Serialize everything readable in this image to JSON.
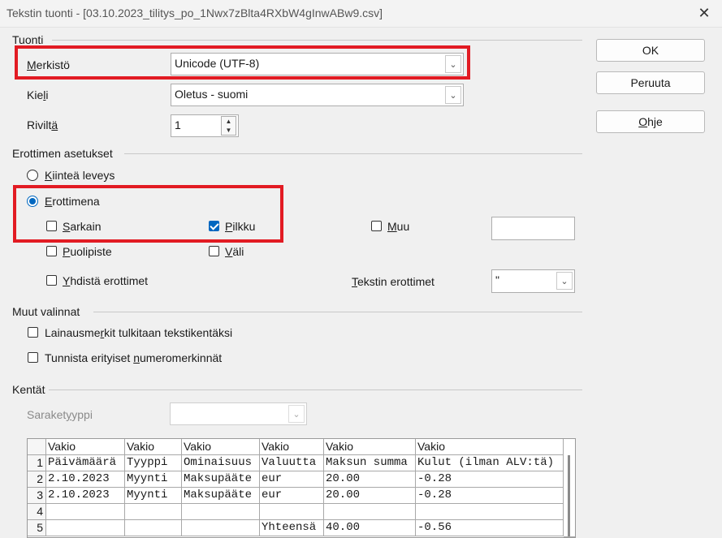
{
  "window": {
    "title": "Tekstin tuonti - [03.10.2023_tilitys_po_1Nwx7zBlta4RXbW4gInwABw9.csv]",
    "close_icon": "close-icon"
  },
  "import": {
    "section": "Tuonti",
    "charset_label": "Merkistö",
    "charset_value": "Unicode (UTF-8)",
    "language_label": "Kieli",
    "language_value": "Oletus - suomi",
    "from_row_label": "Riviltä",
    "from_row_value": "1"
  },
  "separator": {
    "section": "Erottimen asetukset",
    "fixed_width": "Kiinteä leveys",
    "separated_by": "Erottimena",
    "tab": "Sarkain",
    "comma": "Pilkku",
    "other": "Muu",
    "semicolon": "Puolipiste",
    "space": "Väli",
    "merge": "Yhdistä erottimet",
    "string_delim_label": "Tekstin erottimet",
    "string_delim_value": "\"",
    "other_value": ""
  },
  "other_options": {
    "section": "Muut valinnat",
    "quoted_as_text": "Lainausmerkit tulkitaan tekstikentäksi",
    "detect_special": "Tunnista erityiset numeromerkinnät"
  },
  "fields": {
    "section": "Kentät",
    "column_type_label": "Saraketyyppi",
    "column_type_value": ""
  },
  "buttons": {
    "ok": "OK",
    "cancel": "Peruuta",
    "help": "Ohje"
  },
  "grid": {
    "headers": [
      "Vakio",
      "Vakio",
      "Vakio",
      "Vakio",
      "Vakio",
      "Vakio"
    ],
    "rows": [
      {
        "num": "1",
        "cells": [
          "Päivämäärä",
          "Tyyppi",
          "Ominaisuus",
          "Valuutta",
          "Maksun summa",
          "Kulut (ilman ALV:tä)"
        ]
      },
      {
        "num": "2",
        "cells": [
          "2.10.2023",
          "Myynti",
          "Maksupääte",
          "eur",
          "20.00",
          "-0.28"
        ]
      },
      {
        "num": "3",
        "cells": [
          "2.10.2023",
          "Myynti",
          "Maksupääte",
          "eur",
          "20.00",
          "-0.28"
        ]
      },
      {
        "num": "4",
        "cells": [
          "",
          "",
          "",
          "",
          "",
          ""
        ]
      },
      {
        "num": "5",
        "cells": [
          "",
          "",
          "",
          "Yhteensä",
          "40.00",
          "-0.56"
        ]
      }
    ]
  },
  "state": {
    "separated_selected": true,
    "fixed_selected": false,
    "comma_checked": true,
    "tab_checked": false,
    "other_checked": false,
    "semicolon_checked": false,
    "space_checked": false,
    "merge_checked": false,
    "quoted_checked": false,
    "detect_checked": false
  },
  "colors": {
    "accent": "#0067c0",
    "highlight": "#e21b23"
  }
}
